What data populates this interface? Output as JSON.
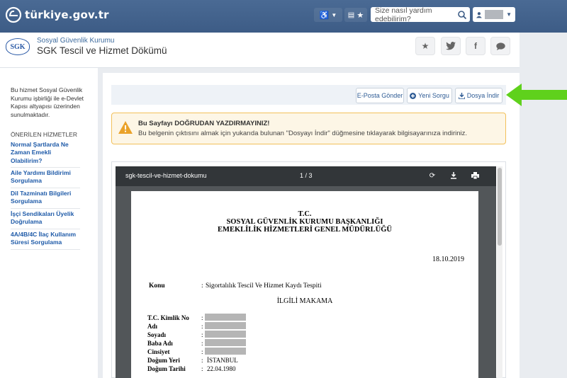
{
  "topbar": {
    "logo_text": "türkiye.gov.tr",
    "search_placeholder": "Size nasıl yardım edebilirim?"
  },
  "header": {
    "institution": "Sosyal Güvenlik Kurumu",
    "title": "SGK Tescil ve Hizmet Dökümü",
    "logo_text": "SGK"
  },
  "sidebar": {
    "info": "Bu hizmet Sosyal Güvenlik Kurumu işbirliği ile e-Devlet Kapısı altyapısı üzerinden sunulmaktadır.",
    "section_title": "ÖNERİLEN HİZMETLER",
    "links": [
      "Normal Şartlarda Ne Zaman Emekli Olabilirim?",
      "Aile Yardımı Bildirimi Sorgulama",
      "Dil Tazminatı Bilgileri Sorgulama",
      "İşçi Sendikaları Üyelik Doğrulama",
      "4A/4B/4C İlaç Kullanım Süresi Sorgulama"
    ]
  },
  "actions": {
    "email": "E-Posta Gönder",
    "new_query": "Yeni Sorgu",
    "download": "Dosya İndir"
  },
  "warning": {
    "title": "Bu Sayfayı DOĞRUDAN YAZDIRMAYINIZ!",
    "text": "Bu belgenin çıktısını almak için yukarıda bulunan \"Dosyayı İndir\" düğmesine tıklayarak bilgisayarınıza indiriniz."
  },
  "viewer": {
    "filename": "sgk-tescil-ve-hizmet-dokumu",
    "page": "1 / 3"
  },
  "document": {
    "line1": "T.C.",
    "line2": "SOSYAL GÜVENLİK KURUMU BAŞKANLIĞI",
    "line3": "EMEKLİLİK HİZMETLERİ GENEL MÜDÜRLÜĞÜ",
    "date": "18.10.2019",
    "konu_label": "Konu",
    "konu_value": "Sigortalılık Tescil Ve Hizmet Kaydı Tespiti",
    "addressee": "İLGİLİ MAKAMA",
    "fields": [
      {
        "label": "T.C. Kimlik No",
        "value": ""
      },
      {
        "label": "Adı",
        "value": ""
      },
      {
        "label": "Soyadı",
        "value": ""
      },
      {
        "label": "Baba Adı",
        "value": ""
      },
      {
        "label": "Cinsiyet",
        "value": ""
      },
      {
        "label": "Doğum Yeri",
        "value": "İSTANBUL"
      },
      {
        "label": "Doğum Tarihi",
        "value": "22.04.1980"
      }
    ]
  },
  "colors": {
    "topbar": "#3d5c86",
    "link": "#1e5aa8",
    "warning_border": "#f2c05a",
    "arrow": "#5fd11c"
  }
}
